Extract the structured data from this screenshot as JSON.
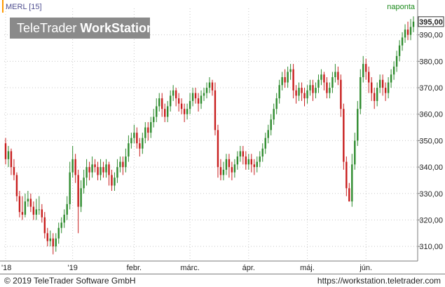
{
  "header": {
    "symbol_label": "MERL [15]",
    "period_label": "naponta"
  },
  "watermark": {
    "part1": "TeleTrader ",
    "part2": "WorkStation"
  },
  "footer": {
    "copyright": "© 2019 TeleTrader Software GmbH",
    "url": "https://workstation.teletrader.com"
  },
  "colors": {
    "up": "#2e8b2e",
    "down": "#c81e1e",
    "grid": "#c8c8c8",
    "last_price_box": "#ffffff"
  },
  "chart_data": {
    "type": "candlestick",
    "title": "",
    "xlabel": "",
    "ylabel": "",
    "ylim": [
      305,
      400
    ],
    "yticks": [
      310,
      320,
      330,
      340,
      350,
      360,
      370,
      380,
      390
    ],
    "ytick_labels": [
      "310,00",
      "320,00",
      "330,00",
      "340,00",
      "350,00",
      "360,00",
      "370,00",
      "380,00",
      "390,00"
    ],
    "xtick_labels": [
      "'18",
      "'19",
      "febr.",
      "márc.",
      "ápr.",
      "máj.",
      "jún."
    ],
    "xtick_index": [
      0,
      24,
      46,
      66,
      87,
      108,
      129
    ],
    "last_price": "395,00",
    "grid": true,
    "candles": [
      [
        349,
        343,
        351,
        341
      ],
      [
        343,
        346,
        348,
        340
      ],
      [
        346,
        340,
        347,
        337
      ],
      [
        340,
        337,
        343,
        335
      ],
      [
        337,
        329,
        338,
        327
      ],
      [
        329,
        323,
        331,
        321
      ],
      [
        323,
        322,
        329,
        320
      ],
      [
        322,
        327,
        330,
        321
      ],
      [
        327,
        328,
        331,
        325
      ],
      [
        328,
        325,
        330,
        323
      ],
      [
        325,
        322,
        327,
        320
      ],
      [
        322,
        324,
        328,
        320
      ],
      [
        324,
        324,
        329,
        322
      ],
      [
        324,
        321,
        326,
        319
      ],
      [
        321,
        315,
        323,
        313
      ],
      [
        315,
        312,
        317,
        310
      ],
      [
        312,
        313,
        316,
        310
      ],
      [
        313,
        310,
        315,
        307
      ],
      [
        310,
        313,
        315,
        308
      ],
      [
        313,
        317,
        319,
        311
      ],
      [
        317,
        319,
        321,
        315
      ],
      [
        319,
        322,
        324,
        317
      ],
      [
        322,
        326,
        329,
        320
      ],
      [
        326,
        338,
        342,
        324
      ],
      [
        338,
        343,
        348,
        336
      ],
      [
        343,
        337,
        345,
        334
      ],
      [
        337,
        325,
        339,
        315
      ],
      [
        325,
        332,
        335,
        323
      ],
      [
        332,
        336,
        339,
        330
      ],
      [
        336,
        340,
        343,
        333
      ],
      [
        340,
        338,
        342,
        335
      ],
      [
        338,
        341,
        344,
        336
      ],
      [
        341,
        340,
        343,
        338
      ],
      [
        340,
        337,
        342,
        335
      ],
      [
        337,
        340,
        343,
        335
      ],
      [
        340,
        338,
        342,
        336
      ],
      [
        338,
        341,
        343,
        336
      ],
      [
        341,
        337,
        342,
        333
      ],
      [
        337,
        333,
        339,
        331
      ],
      [
        333,
        336,
        338,
        331
      ],
      [
        336,
        340,
        343,
        334
      ],
      [
        340,
        342,
        344,
        338
      ],
      [
        342,
        340,
        344,
        337
      ],
      [
        340,
        344,
        347,
        338
      ],
      [
        344,
        349,
        352,
        342
      ],
      [
        349,
        351,
        353,
        347
      ],
      [
        351,
        353,
        356,
        349
      ],
      [
        353,
        349,
        355,
        347
      ],
      [
        349,
        347,
        351,
        344
      ],
      [
        347,
        351,
        353,
        345
      ],
      [
        351,
        355,
        357,
        349
      ],
      [
        355,
        353,
        357,
        350
      ],
      [
        353,
        357,
        359,
        351
      ],
      [
        357,
        359,
        362,
        355
      ],
      [
        359,
        363,
        366,
        357
      ],
      [
        363,
        366,
        368,
        361
      ],
      [
        366,
        362,
        368,
        359
      ],
      [
        362,
        359,
        364,
        357
      ],
      [
        359,
        363,
        365,
        357
      ],
      [
        363,
        367,
        369,
        361
      ],
      [
        367,
        369,
        371,
        365
      ],
      [
        369,
        366,
        370,
        363
      ],
      [
        366,
        364,
        368,
        361
      ],
      [
        364,
        362,
        366,
        360
      ],
      [
        362,
        360,
        364,
        357
      ],
      [
        360,
        362,
        364,
        358
      ],
      [
        362,
        365,
        368,
        360
      ],
      [
        365,
        368,
        370,
        363
      ],
      [
        368,
        366,
        370,
        364
      ],
      [
        366,
        364,
        368,
        361
      ],
      [
        364,
        367,
        369,
        362
      ],
      [
        367,
        368,
        370,
        365
      ],
      [
        368,
        370,
        372,
        366
      ],
      [
        370,
        372,
        374,
        368
      ],
      [
        372,
        369,
        373,
        367
      ],
      [
        369,
        354,
        372,
        352
      ],
      [
        354,
        340,
        356,
        336
      ],
      [
        340,
        337,
        343,
        335
      ],
      [
        337,
        339,
        342,
        335
      ],
      [
        339,
        343,
        345,
        337
      ],
      [
        343,
        340,
        345,
        336
      ],
      [
        340,
        338,
        342,
        335
      ],
      [
        338,
        341,
        343,
        336
      ],
      [
        341,
        344,
        346,
        339
      ],
      [
        344,
        346,
        348,
        342
      ],
      [
        346,
        344,
        348,
        341
      ],
      [
        344,
        341,
        346,
        339
      ],
      [
        341,
        343,
        345,
        339
      ],
      [
        343,
        341,
        345,
        338
      ],
      [
        341,
        340,
        343,
        337
      ],
      [
        340,
        342,
        344,
        338
      ],
      [
        342,
        344,
        346,
        340
      ],
      [
        344,
        347,
        349,
        342
      ],
      [
        347,
        351,
        353,
        345
      ],
      [
        351,
        354,
        356,
        349
      ],
      [
        354,
        358,
        360,
        352
      ],
      [
        358,
        362,
        364,
        356
      ],
      [
        362,
        366,
        368,
        360
      ],
      [
        366,
        371,
        373,
        364
      ],
      [
        371,
        374,
        376,
        369
      ],
      [
        374,
        372,
        377,
        370
      ],
      [
        372,
        376,
        378,
        370
      ],
      [
        376,
        377,
        379,
        373
      ],
      [
        377,
        369,
        379,
        366
      ],
      [
        369,
        367,
        371,
        364
      ],
      [
        367,
        370,
        372,
        365
      ],
      [
        370,
        368,
        372,
        365
      ],
      [
        368,
        366,
        370,
        363
      ],
      [
        366,
        369,
        371,
        364
      ],
      [
        369,
        371,
        373,
        367
      ],
      [
        371,
        368,
        373,
        365
      ],
      [
        368,
        370,
        372,
        366
      ],
      [
        370,
        373,
        375,
        368
      ],
      [
        373,
        375,
        377,
        371
      ],
      [
        375,
        372,
        376,
        369
      ],
      [
        372,
        368,
        374,
        366
      ],
      [
        368,
        370,
        372,
        366
      ],
      [
        370,
        374,
        376,
        368
      ],
      [
        374,
        376,
        379,
        372
      ],
      [
        376,
        373,
        378,
        371
      ],
      [
        373,
        362,
        375,
        359
      ],
      [
        362,
        342,
        364,
        339
      ],
      [
        342,
        332,
        344,
        329
      ],
      [
        332,
        327,
        334,
        327
      ],
      [
        327,
        341,
        345,
        325
      ],
      [
        341,
        350,
        353,
        339
      ],
      [
        350,
        362,
        365,
        348
      ],
      [
        362,
        374,
        377,
        360
      ],
      [
        374,
        379,
        382,
        372
      ],
      [
        379,
        376,
        381,
        373
      ],
      [
        376,
        372,
        378,
        368
      ],
      [
        372,
        368,
        374,
        365
      ],
      [
        368,
        365,
        370,
        362
      ],
      [
        365,
        370,
        372,
        363
      ],
      [
        370,
        373,
        375,
        368
      ],
      [
        373,
        370,
        375,
        367
      ],
      [
        370,
        368,
        372,
        365
      ],
      [
        368,
        372,
        374,
        366
      ],
      [
        372,
        375,
        377,
        370
      ],
      [
        375,
        378,
        380,
        373
      ],
      [
        378,
        382,
        384,
        376
      ],
      [
        382,
        386,
        388,
        380
      ],
      [
        386,
        389,
        391,
        384
      ],
      [
        389,
        392,
        394,
        387
      ],
      [
        392,
        390,
        395,
        388
      ],
      [
        390,
        393,
        396,
        388
      ],
      [
        393,
        395,
        397,
        391
      ]
    ]
  }
}
